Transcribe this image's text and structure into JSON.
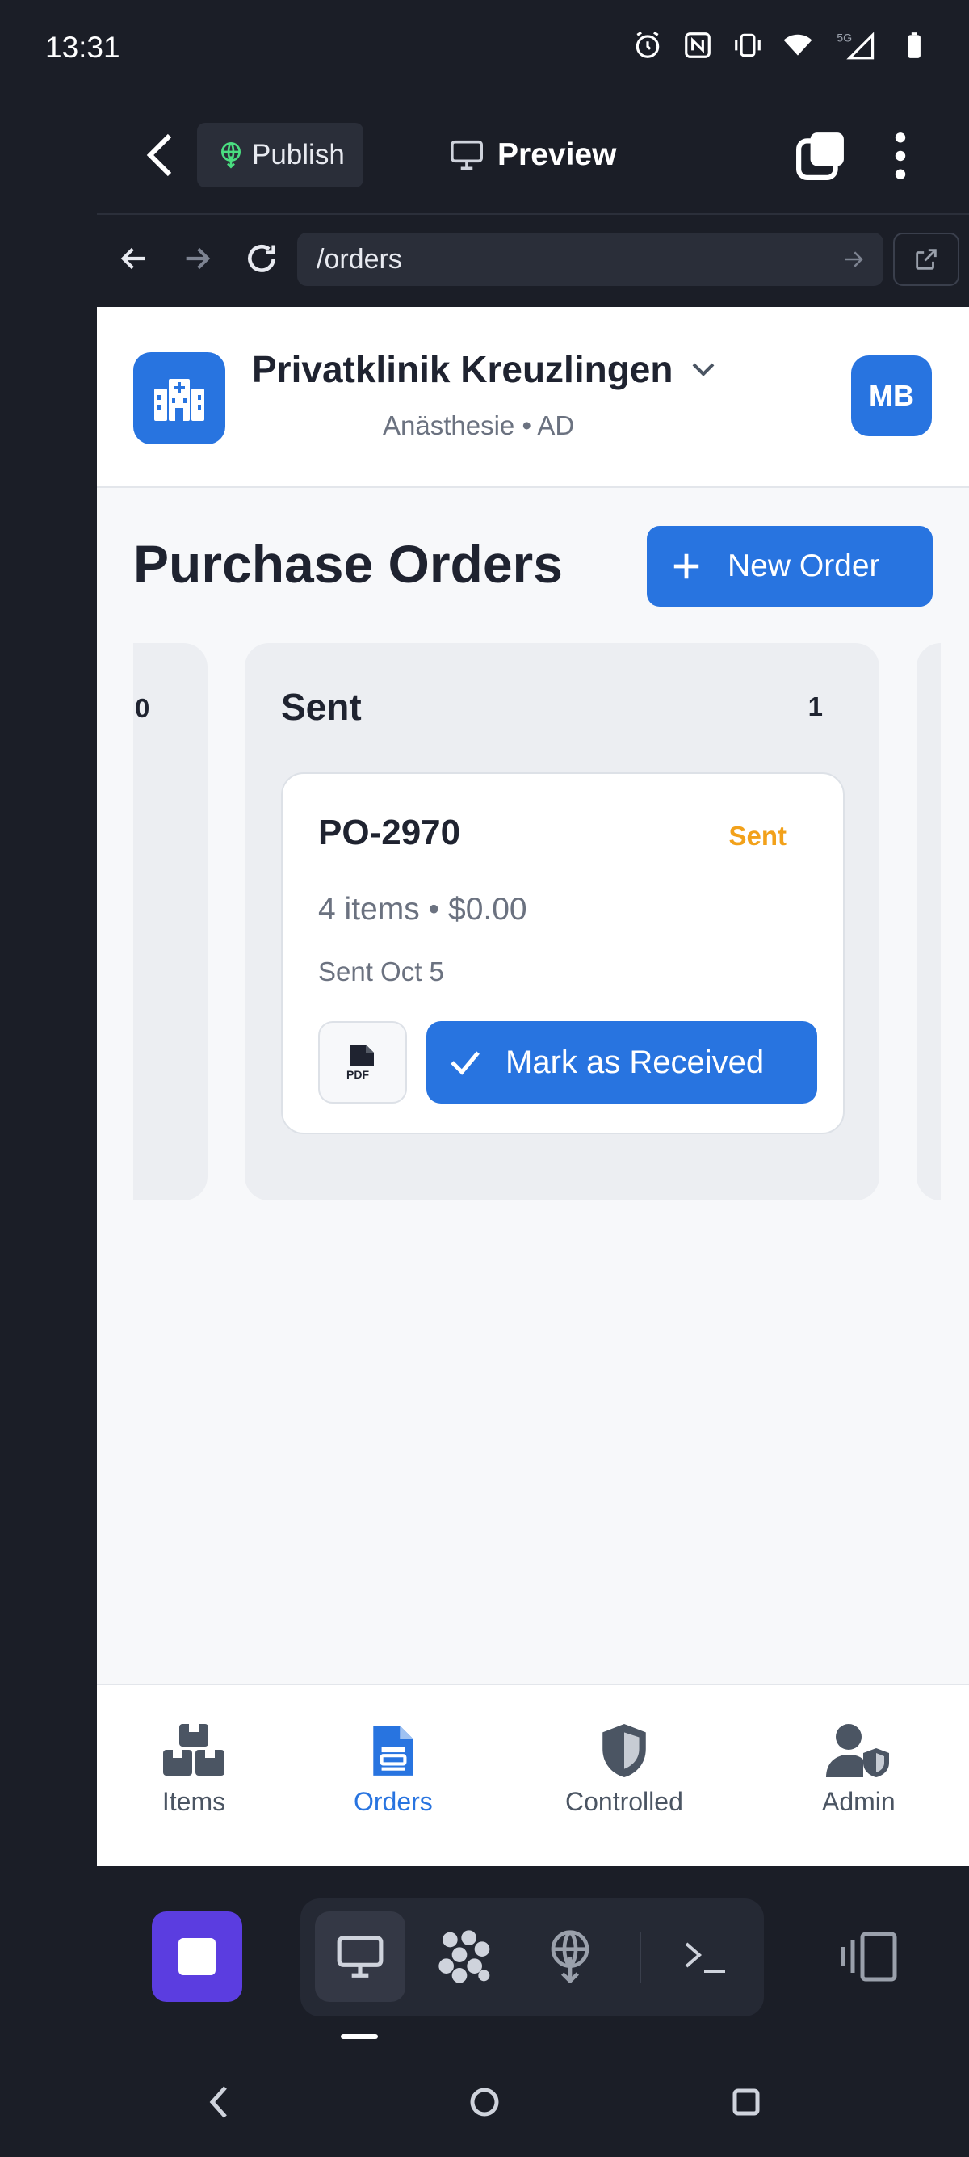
{
  "status_bar": {
    "time": "13:31",
    "network": "5G",
    "icons": [
      "alarm-icon",
      "nfc-icon",
      "vibrate-icon",
      "wifi-icon",
      "signal-icon",
      "battery-icon"
    ]
  },
  "editor_toolbar": {
    "publish_label": "Publish",
    "preview_label": "Preview"
  },
  "browser": {
    "url": "/orders"
  },
  "header": {
    "clinic_name": "Privatklinik Kreuzlingen",
    "clinic_sub": "Anästhesie • AD",
    "avatar_initials": "MB"
  },
  "main": {
    "title": "Purchase Orders",
    "new_order_label": "New Order",
    "columns": [
      {
        "title": "",
        "count": "0"
      },
      {
        "title": "Sent",
        "count": "1"
      }
    ],
    "order": {
      "number": "PO-2970",
      "status": "Sent",
      "summary": "4 items • $0.00",
      "date": "Sent Oct 5",
      "pdf_label": "PDF",
      "action_label": "Mark as Received"
    }
  },
  "bottom_nav": [
    {
      "label": "Items",
      "icon": "boxes-icon",
      "active": false
    },
    {
      "label": "Orders",
      "icon": "document-icon",
      "active": true
    },
    {
      "label": "Controlled",
      "icon": "shield-icon",
      "active": false
    },
    {
      "label": "Admin",
      "icon": "user-shield-icon",
      "active": false
    }
  ],
  "colors": {
    "accent": "#2874e0",
    "status_sent": "#f2a11a",
    "dock_stop": "#5b3de0",
    "background_dark": "#1b1e27"
  }
}
